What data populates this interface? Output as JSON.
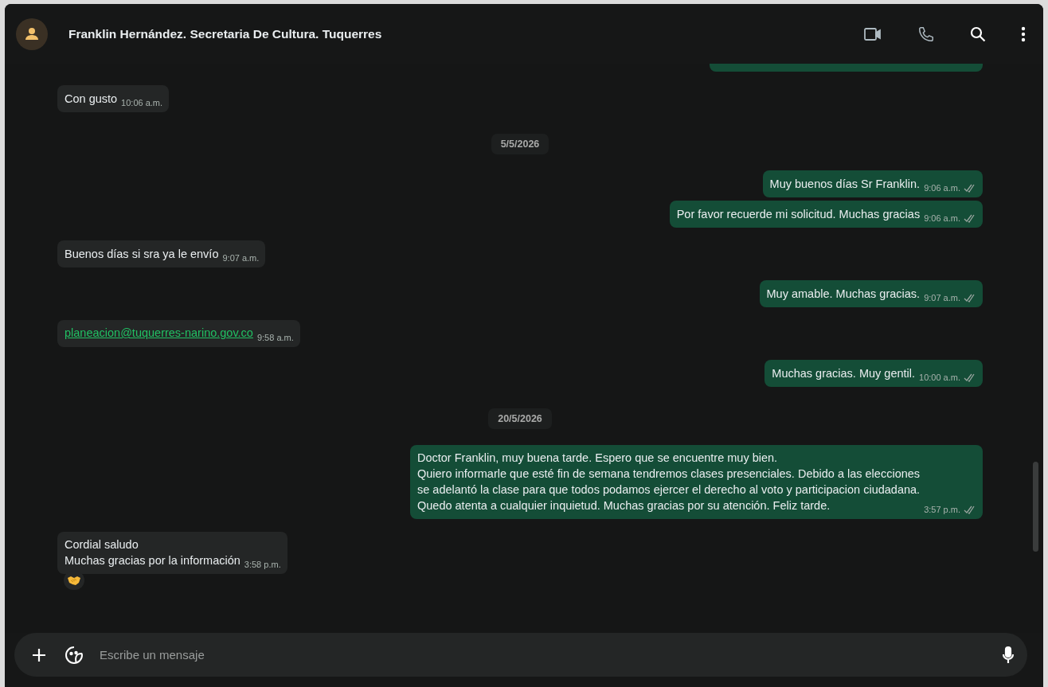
{
  "header": {
    "title": "Franklin Hernández. Secretaria De Cultura. Tuquerres"
  },
  "messages": [
    {
      "kind": "partial"
    },
    {
      "kind": "in",
      "text": "Con gusto",
      "time": "10:06 a.m."
    },
    {
      "kind": "date",
      "text": "5/5/2026"
    },
    {
      "kind": "out",
      "text": "Muy buenos días Sr Franklin.",
      "time": "9:06 a.m.",
      "read": true
    },
    {
      "kind": "out",
      "text": "Por favor recuerde mi solicitud. Muchas gracias",
      "time": "9:06 a.m.",
      "read": true
    },
    {
      "kind": "in",
      "text": "Buenos días si sra ya le envío",
      "time": "9:07 a.m."
    },
    {
      "kind": "out",
      "text": "Muy amable. Muchas gracias.",
      "time": "9:07 a.m.",
      "read": true
    },
    {
      "kind": "link",
      "text": "planeacion@tuquerres-narino.gov.co",
      "time": "9:58 a.m."
    },
    {
      "kind": "out",
      "text": "Muchas gracias. Muy gentil.",
      "time": "10:00 a.m.",
      "read": true
    },
    {
      "kind": "date",
      "text": "20/5/2026"
    },
    {
      "kind": "out",
      "text": "Doctor Franklin, muy buena tarde. Espero que se encuentre muy bien.\nQuiero informarle que esté fin de semana tendremos clases presenciales. Debido a las elecciones\nse adelantó la clase para que todos podamos ejercer el derecho al voto y participacion ciudadana.\nQuedo atenta a cualquier inquietud. Muchas gracias por su atención. Feliz tarde.",
      "time": "3:57 p.m.",
      "read": true
    },
    {
      "kind": "in",
      "text": "Cordial saludo\nMuchas gracias por la información",
      "time": "3:58 p.m.",
      "reacted": true
    }
  ],
  "composer": {
    "placeholder": "Escribe un mensaje"
  }
}
